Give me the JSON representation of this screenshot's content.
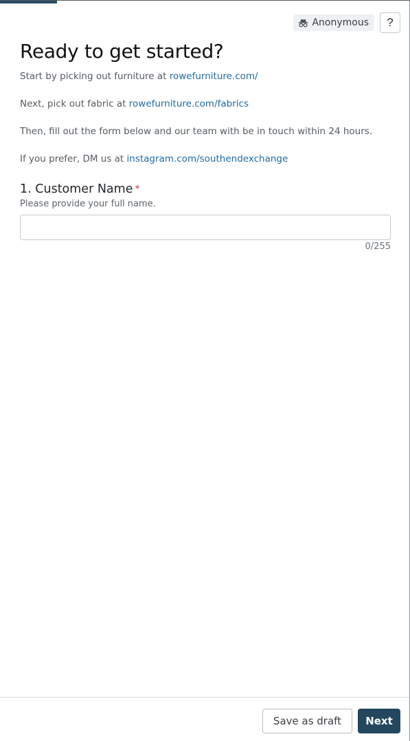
{
  "progress": {
    "fraction": 0.14
  },
  "header": {
    "anonymous_label": "Anonymous",
    "help_label": "?"
  },
  "main": {
    "title": "Ready to get started?",
    "intro": [
      {
        "text": "Start by picking out furniture at ",
        "link": "rowefurniture.com/"
      },
      {
        "text": "Next, pick out fabric at ",
        "link": "rowefurniture.com/fabrics"
      },
      {
        "text": "Then, fill out the form below and our team with be in touch within 24 hours.",
        "link": ""
      },
      {
        "text": "If you prefer, DM us at ",
        "link": "instagram.com/southendexchange"
      }
    ],
    "question": {
      "number_title": "1. Customer Name",
      "required_mark": "*",
      "help_text": "Please provide your full name.",
      "value": "",
      "char_count": "0/255"
    }
  },
  "footer": {
    "save_draft_label": "Save as draft",
    "next_label": "Next"
  },
  "colors": {
    "primary": "#22475f",
    "link": "#1f6aa5",
    "required": "#d43a3a"
  }
}
